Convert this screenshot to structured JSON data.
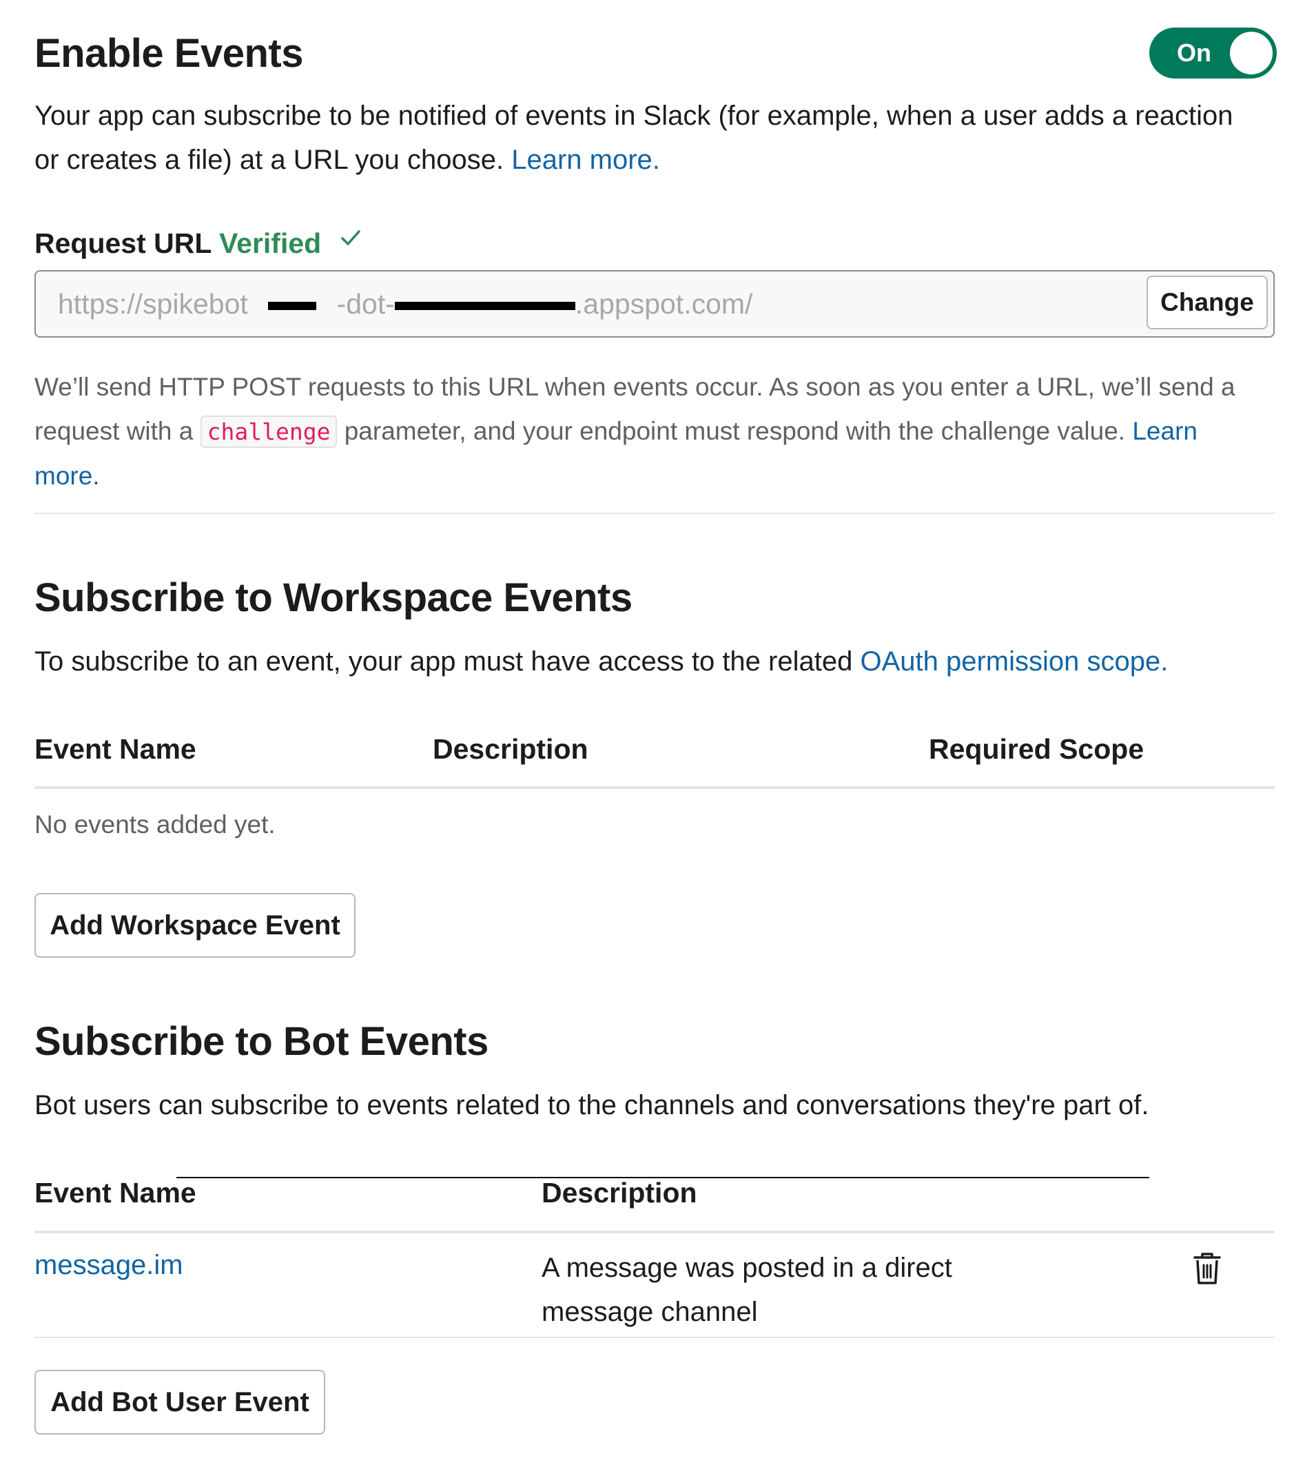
{
  "enable_events": {
    "title": "Enable Events",
    "toggle_label": "On",
    "description": "Your app can subscribe to be notified of events in Slack (for example, when a user adds a reaction or creates a file) at a URL you choose.",
    "learn_more": "Learn more."
  },
  "request_url": {
    "label": "Request URL",
    "status": "Verified",
    "status_icon": "check-icon",
    "value_prefix": "https://spikebot",
    "value_middle": "-dot-",
    "value_suffix": ".appspot.com/",
    "change_button": "Change",
    "help_before": "We’ll send HTTP POST requests to this URL when events occur. As soon as you enter a URL, we’ll send a request with a",
    "help_code": "challenge",
    "help_after": "parameter, and your endpoint must respond with the challenge value.",
    "learn_more": "Learn more."
  },
  "workspace_events": {
    "title": "Subscribe to Workspace Events",
    "description": "To subscribe to an event, your app must have access to the related",
    "scope_link": "OAuth permission scope.",
    "columns": [
      "Event Name",
      "Description",
      "Required Scope"
    ],
    "empty_text": "No events added yet.",
    "add_button": "Add Workspace Event"
  },
  "bot_events": {
    "title": "Subscribe to Bot Events",
    "description": "Bot users can subscribe to events related to the channels and conversations they're part of.",
    "columns": [
      "Event Name",
      "Description"
    ],
    "rows": [
      {
        "event": "message.im",
        "description_line1": "A message was posted in a direct",
        "description_line2": "message channel",
        "action_icon": "trash-icon"
      }
    ],
    "add_button": "Add Bot User Event"
  },
  "colors": {
    "toggle_on": "#007a5a",
    "link": "#1264a3",
    "verified": "#2e8b57",
    "code": "#e01e5a"
  }
}
